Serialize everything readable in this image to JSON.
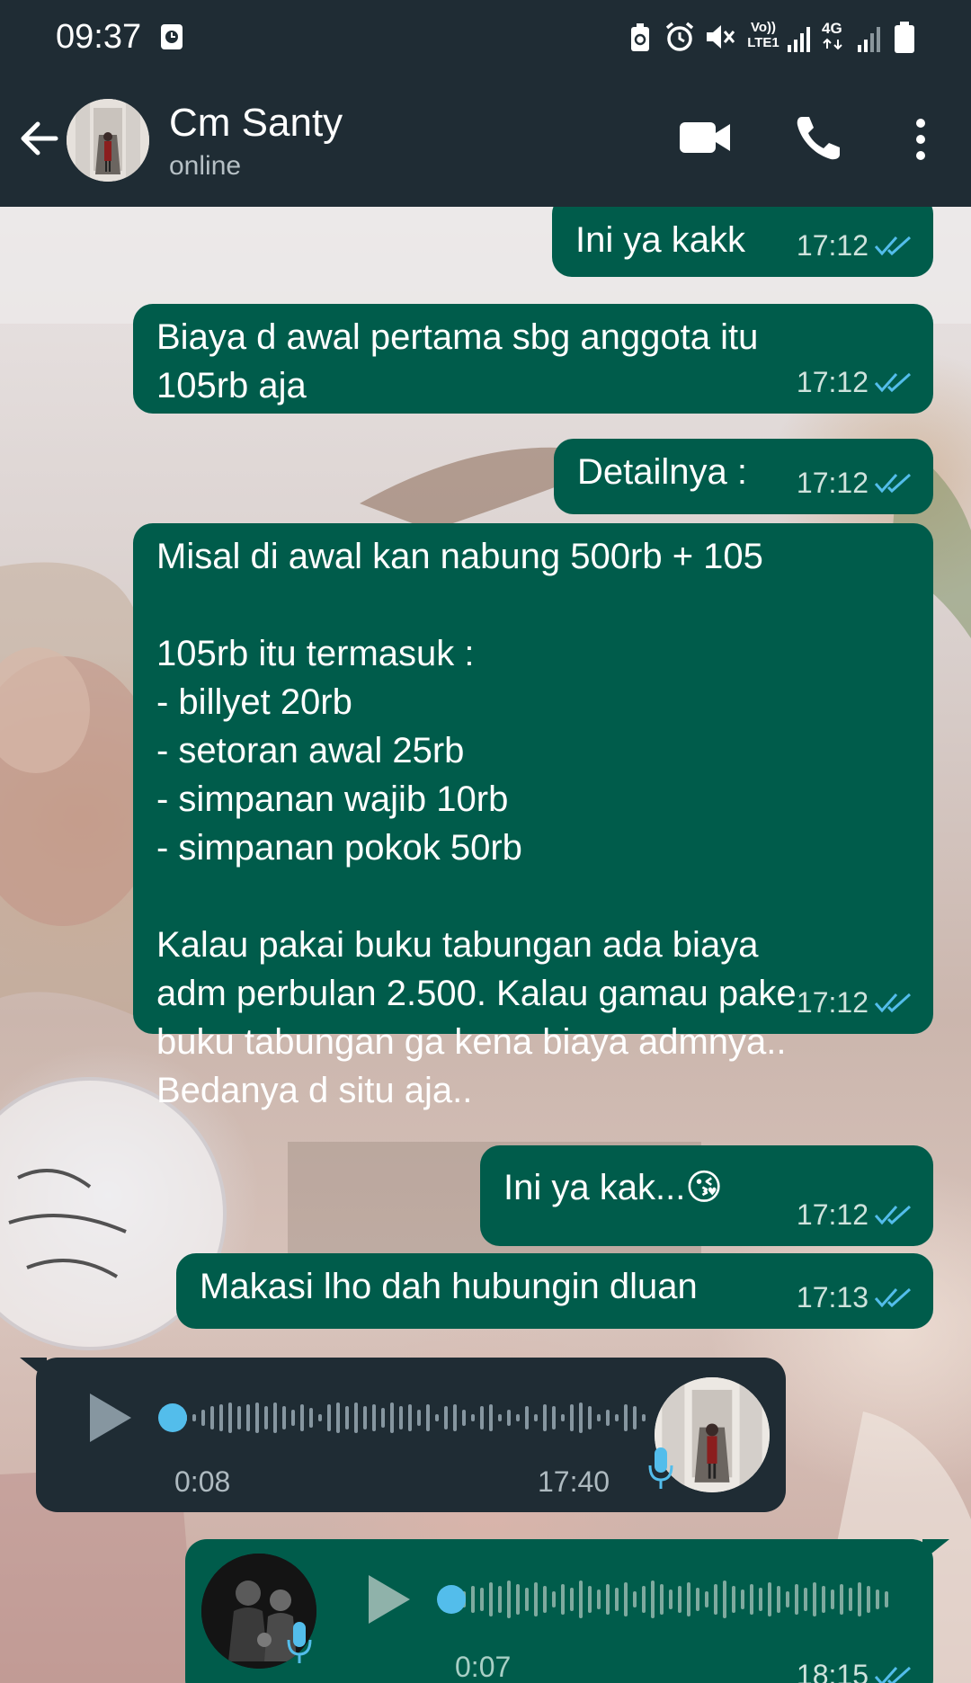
{
  "status_bar": {
    "time": "09:37",
    "icons": [
      "clock-icon",
      "battery-saver-icon",
      "alarm-icon",
      "mute-icon",
      "volte-icon",
      "signal-icon",
      "4g-icon",
      "signal-icon",
      "battery-icon"
    ],
    "volte_label": "Vo)) LTE1",
    "network_label": "4G"
  },
  "header": {
    "contact_name": "Cm Santy",
    "contact_status": "online",
    "icons": [
      "back-arrow-icon",
      "video-call-icon",
      "phone-icon",
      "more-vert-icon"
    ]
  },
  "messages": [
    {
      "type": "text",
      "text": "Ini ya kakk",
      "time": "17:12"
    },
    {
      "type": "text",
      "text": "Biaya d awal pertama sbg anggota itu\n105rb aja",
      "time": "17:12"
    },
    {
      "type": "text",
      "text": "Detailnya :",
      "time": "17:12"
    },
    {
      "type": "text",
      "text": "Misal di awal kan nabung 500rb + 105\n\n105rb itu termasuk :\n- billyet 20rb\n- setoran awal 25rb\n- simpanan wajib 10rb\n- simpanan pokok 50rb\n\nKalau pakai buku tabungan ada biaya\nadm perbulan 2.500. Kalau gamau pake\nbuku tabungan ga kena biaya admnya..\nBedanya d situ aja..",
      "time": "17:12"
    },
    {
      "type": "text",
      "text": "Ini ya kak...😘",
      "time": "17:12"
    },
    {
      "type": "text",
      "text": "Makasi lho dah hubungin dluan",
      "time": "17:13"
    },
    {
      "type": "voice",
      "duration": "0:08",
      "time": "17:40",
      "direction": "incoming"
    },
    {
      "type": "voice",
      "duration": "0:07",
      "time": "18:15",
      "direction": "outgoing"
    }
  ],
  "colors": {
    "header_bg": "#1f2c34",
    "outgoing_bubble": "#005c4b",
    "incoming_bubble": "#1f2c34",
    "read_ticks": "#53bdeb",
    "voice_dot": "#53bdeb"
  }
}
